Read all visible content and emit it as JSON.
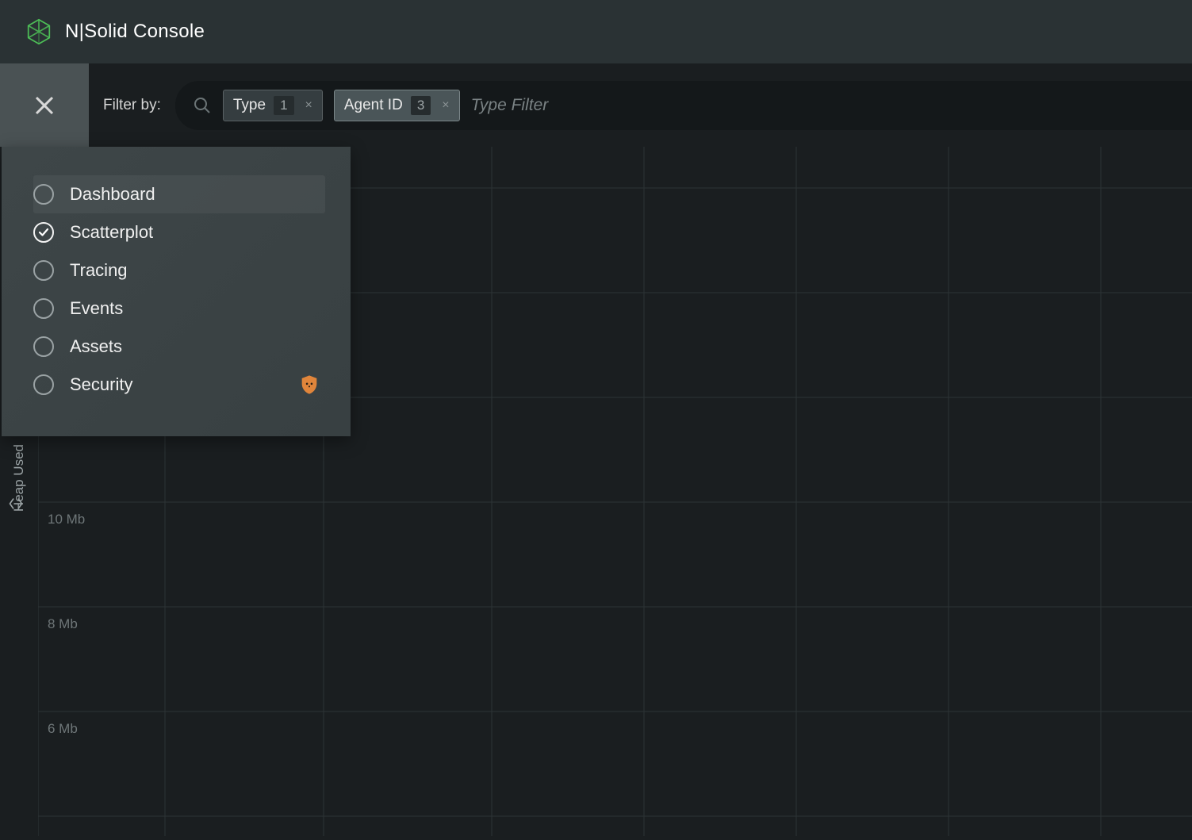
{
  "header": {
    "app_title": "N|Solid Console"
  },
  "filter": {
    "label": "Filter by:",
    "chips": [
      {
        "label": "Type",
        "count": "1",
        "active": false
      },
      {
        "label": "Agent ID",
        "count": "3",
        "active": true
      }
    ],
    "placeholder": "Type Filter"
  },
  "nav": {
    "items": [
      {
        "label": "Dashboard",
        "checked": false,
        "hover": true,
        "shield": false
      },
      {
        "label": "Scatterplot",
        "checked": true,
        "hover": false,
        "shield": false
      },
      {
        "label": "Tracing",
        "checked": false,
        "hover": false,
        "shield": false
      },
      {
        "label": "Events",
        "checked": false,
        "hover": false,
        "shield": false
      },
      {
        "label": "Assets",
        "checked": false,
        "hover": false,
        "shield": false
      },
      {
        "label": "Security",
        "checked": false,
        "hover": false,
        "shield": true
      }
    ]
  },
  "chart": {
    "y_label": "Heap Used",
    "y_ticks": [
      "10 Mb",
      "8 Mb",
      "6 Mb"
    ]
  },
  "chart_data": {
    "type": "scatter",
    "title": "",
    "xlabel": "",
    "ylabel": "Heap Used",
    "y_unit": "Mb",
    "ylim": [
      6,
      14
    ],
    "y_ticks": [
      6,
      8,
      10
    ],
    "x": [],
    "series": []
  }
}
